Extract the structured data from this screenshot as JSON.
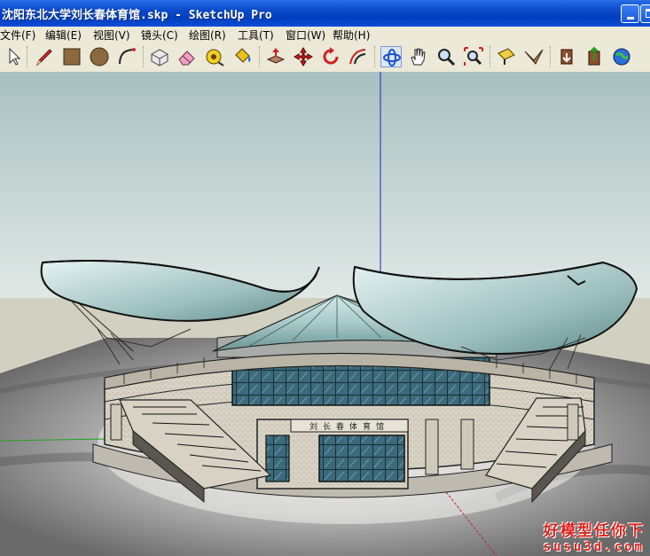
{
  "window": {
    "title": "沈阳东北大学刘长春体育馆.skp - SketchUp Pro",
    "buttons": [
      "minimize",
      "maximize"
    ]
  },
  "menu": [
    {
      "label": "文件(F)"
    },
    {
      "label": "编辑(E)"
    },
    {
      "label": "视图(V)"
    },
    {
      "label": "镜头(C)"
    },
    {
      "label": "绘图(R)"
    },
    {
      "label": "工具(T)"
    },
    {
      "label": "窗口(W)"
    },
    {
      "label": "帮助(H)"
    }
  ],
  "toolbar": [
    {
      "name": "select-icon"
    },
    {
      "name": "line-pencil-icon"
    },
    {
      "name": "rectangle-icon"
    },
    {
      "name": "circle-icon"
    },
    {
      "name": "arc-icon"
    },
    {
      "name": "make-component-icon"
    },
    {
      "name": "eraser-icon"
    },
    {
      "name": "tape-measure-icon"
    },
    {
      "name": "paint-bucket-icon"
    },
    {
      "name": "push-pull-icon"
    },
    {
      "name": "move-icon"
    },
    {
      "name": "rotate-icon"
    },
    {
      "name": "offset-icon"
    },
    {
      "name": "orbit-icon",
      "active": true
    },
    {
      "name": "pan-icon"
    },
    {
      "name": "zoom-icon"
    },
    {
      "name": "zoom-extents-icon"
    },
    {
      "name": "position-camera-icon"
    },
    {
      "name": "walk-icon"
    },
    {
      "name": "get-models-icon"
    },
    {
      "name": "share-model-icon"
    },
    {
      "name": "google-earth-icon"
    }
  ],
  "viewport": {
    "colors": {
      "sky_top": "#a9c0c0",
      "sky_bottom": "#e0e8e5",
      "ground": "#d2d0c0",
      "axis_blue": "#2020c8",
      "axis_green": "#20a020",
      "axis_red": "#c02020"
    },
    "sign_text": "刘长春体育馆"
  },
  "watermark": {
    "line1": "好模型任你下",
    "line2": "susu3d.com"
  }
}
